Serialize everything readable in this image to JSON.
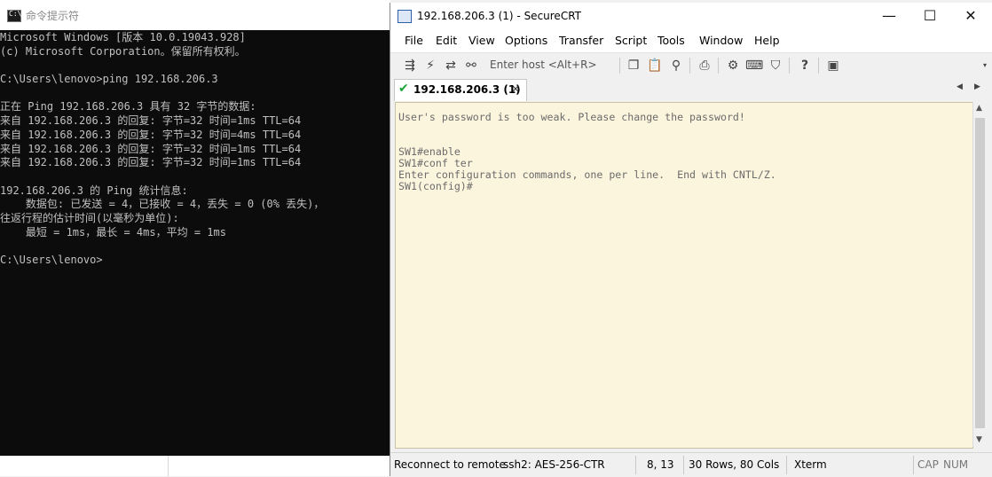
{
  "cmd": {
    "title": "命令提示符",
    "icon": "cmd-icon",
    "lines": [
      "Microsoft Windows [版本 10.0.19043.928]",
      "(c) Microsoft Corporation。保留所有权利。",
      "",
      "C:\\Users\\lenovo>ping 192.168.206.3",
      "",
      "正在 Ping 192.168.206.3 具有 32 字节的数据:",
      "来自 192.168.206.3 的回复: 字节=32 时间=1ms TTL=64",
      "来自 192.168.206.3 的回复: 字节=32 时间=4ms TTL=64",
      "来自 192.168.206.3 的回复: 字节=32 时间=1ms TTL=64",
      "来自 192.168.206.3 的回复: 字节=32 时间=1ms TTL=64",
      "",
      "192.168.206.3 的 Ping 统计信息:",
      "    数据包: 已发送 = 4，已接收 = 4，丢失 = 0 (0% 丢失)，",
      "往返行程的估计时间(以毫秒为单位):",
      "    最短 = 1ms，最长 = 4ms，平均 = 1ms",
      "",
      "C:\\Users\\lenovo>"
    ]
  },
  "crt": {
    "title": "192.168.206.3 (1) - SecureCRT",
    "window_buttons": {
      "minimize": "—",
      "maximize": "☐",
      "close": "✕"
    },
    "menu": [
      "File",
      "Edit",
      "View",
      "Options",
      "Transfer",
      "Script",
      "Tools",
      "Window",
      "Help"
    ],
    "toolbar": {
      "host_placeholder": "Enter host <Alt+R>",
      "icons": [
        "connect-icon",
        "quick-connect-icon",
        "reconnect-icon",
        "disconnect-icon",
        "copy-icon",
        "paste-icon",
        "find-icon",
        "print-icon",
        "settings-icon",
        "keymap-icon",
        "sftp-icon",
        "help-icon",
        "script-icon"
      ]
    },
    "tab": {
      "label": "192.168.206.3 (1)",
      "close": "×"
    },
    "terminal_lines": [
      "User's password is too weak. Please change the password!",
      "",
      "",
      "SW1#enable",
      "SW1#conf ter",
      "Enter configuration commands, one per line.  End with CNTL/Z.",
      "SW1(config)#"
    ],
    "status": {
      "message": "Reconnect to remote",
      "protocol": "ssh2: AES-256-CTR",
      "cursor": "8,  13",
      "size": "30 Rows, 80 Cols",
      "term_type": "Xterm",
      "cap": "CAP",
      "num": "NUM"
    },
    "colors": {
      "terminal_bg": "#fcf5de",
      "terminal_fg": "#6b6b6b",
      "cmd_bg": "#0c0c0c",
      "cmd_fg": "#c0c0c0"
    }
  }
}
